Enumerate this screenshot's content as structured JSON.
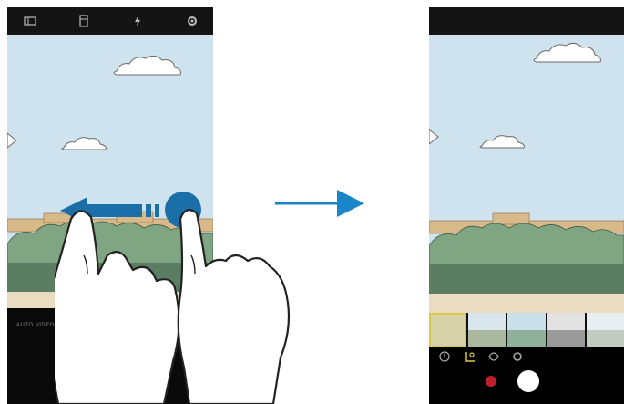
{
  "left_phone": {
    "top_icons": [
      "hdr-icon",
      "aspect-ratio-icon",
      "flash-icon",
      "settings-icon"
    ],
    "mode_text": "AUTO   VIDEO",
    "gesture": "swipe-left",
    "record_color": "#c01e2e"
  },
  "right_phone": {
    "filter_count": 5,
    "selected_filter_index": 0,
    "tabs": [
      "timer-icon",
      "filter-icon",
      "effects-icon",
      "settings-icon"
    ],
    "active_tab_index": 1,
    "accent": "#d9c94a",
    "record_color": "#c01e2e"
  },
  "transition_arrow": {
    "color": "#1a86c8",
    "direction": "right"
  },
  "swipe_arrow": {
    "color": "#1a6fa8",
    "direction": "left"
  }
}
